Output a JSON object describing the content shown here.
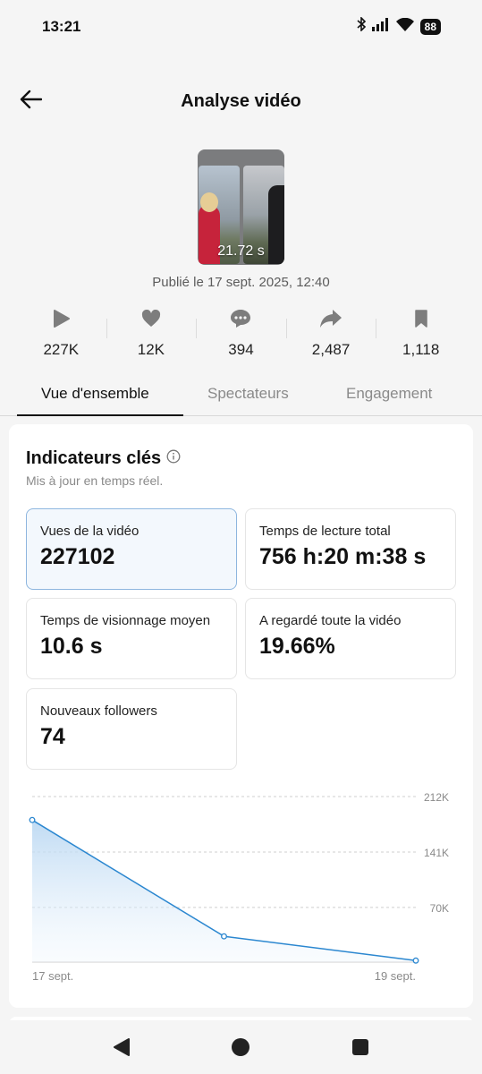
{
  "status_bar": {
    "time": "13:21",
    "battery": "88",
    "icons": [
      "bluetooth-icon",
      "signal-icon",
      "wifi-icon",
      "battery-icon"
    ]
  },
  "header": {
    "title": "Analyse vidéo",
    "back_icon": "arrow-left-icon"
  },
  "video": {
    "duration": "21.72 s",
    "published": "Publié le 17 sept. 2025, 12:40"
  },
  "metrics": [
    {
      "icon": "play-icon",
      "value": "227K"
    },
    {
      "icon": "heart-icon",
      "value": "12K"
    },
    {
      "icon": "comment-icon",
      "value": "394"
    },
    {
      "icon": "share-icon",
      "value": "2,487"
    },
    {
      "icon": "bookmark-icon",
      "value": "1,118"
    }
  ],
  "tabs": [
    {
      "label": "Vue d'ensemble",
      "active": true
    },
    {
      "label": "Spectateurs",
      "active": false
    },
    {
      "label": "Engagement",
      "active": false
    }
  ],
  "key_indicators": {
    "title": "Indicateurs clés",
    "subtitle": "Mis à jour en temps réel.",
    "info_icon": "info-icon",
    "cards": [
      {
        "label": "Vues de la vidéo",
        "value": "227102",
        "selected": true
      },
      {
        "label": "Temps de lecture total",
        "value": "756 h:20 m:38 s"
      },
      {
        "label": "Temps de visionnage moyen",
        "value": "10.6 s"
      },
      {
        "label": "A regardé toute la vidéo",
        "value": "19.66%"
      },
      {
        "label": "Nouveaux followers",
        "value": "74"
      }
    ]
  },
  "colors": {
    "accent_line": "#2b87d0",
    "selected_card_bg": "#f3f8fd",
    "selected_card_border": "#8eb6df"
  },
  "chart_data": {
    "type": "area",
    "x": [
      "17 sept.",
      "18 sept.",
      "19 sept."
    ],
    "x_tick_labels": [
      "17 sept.",
      "19 sept."
    ],
    "series": [
      {
        "values": [
          182000,
          33000,
          2000
        ]
      }
    ],
    "y_ticks": [
      70000,
      141000,
      212000
    ],
    "y_tick_labels": [
      "70K",
      "141K",
      "212K"
    ],
    "ylim": [
      0,
      212000
    ],
    "grid": true,
    "y_axis_side": "right"
  },
  "nav_bar": {
    "icons": [
      "back-triangle-icon",
      "home-circle-icon",
      "recents-square-icon"
    ]
  }
}
